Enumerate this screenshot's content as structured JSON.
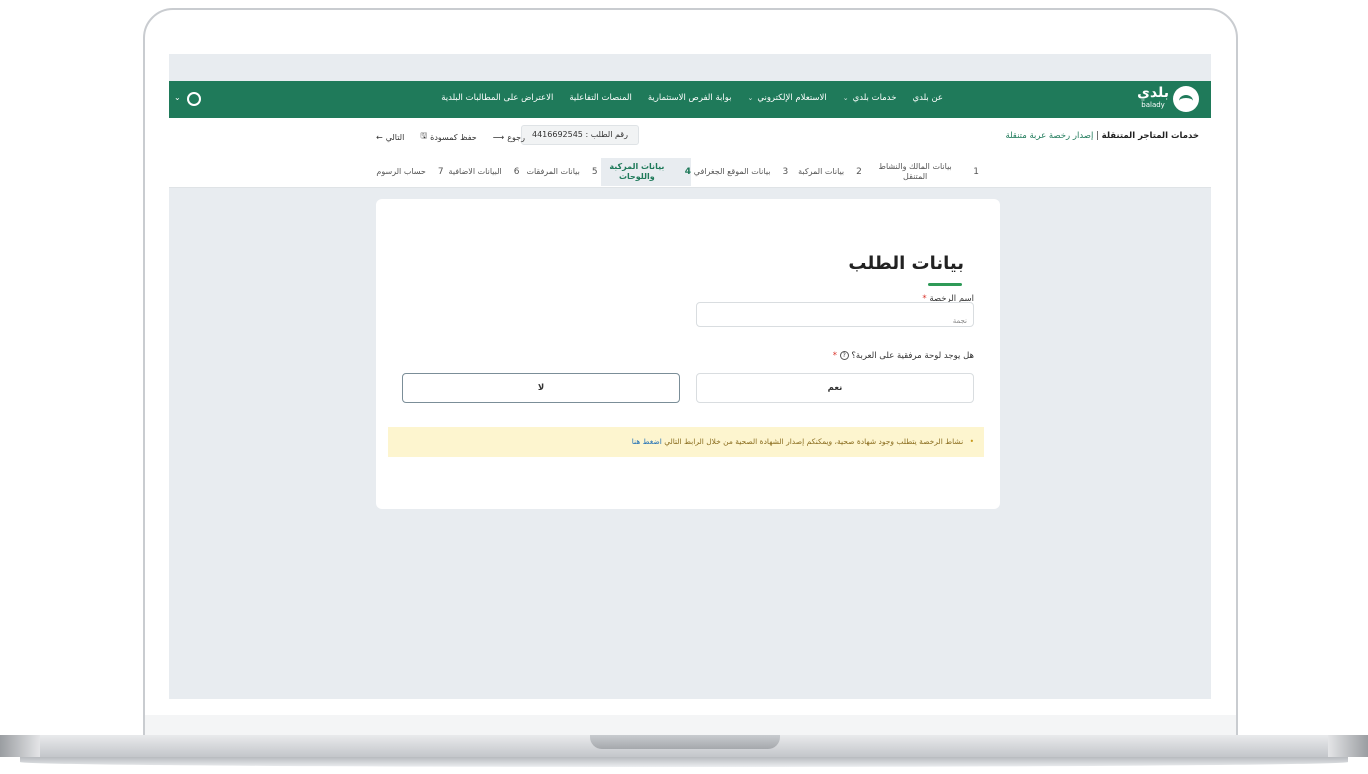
{
  "header": {
    "logo_text": "بلدي",
    "logo_sub": "balady",
    "nav": [
      {
        "label": "عن بلدي",
        "has_chevron": false
      },
      {
        "label": "خدمات بلدي",
        "has_chevron": true
      },
      {
        "label": "الاستعلام الإلكتروني",
        "has_chevron": true
      },
      {
        "label": "بوابة الفرص الاستثمارية",
        "has_chevron": false
      },
      {
        "label": "المنصات التفاعلية",
        "has_chevron": false
      },
      {
        "label": "الاعتراض على المطالبات البلدية",
        "has_chevron": false
      }
    ]
  },
  "breadcrumb": {
    "root": "خدمات المتاجر المتنقلة",
    "separator": "|",
    "current": "إصدار رخصة عربة متنقلة"
  },
  "order": {
    "label": "رقم الطلب : 4416692545"
  },
  "toolbar": {
    "back": "رجوع",
    "save_draft": "حفظ كمسودة",
    "next": "التالي"
  },
  "steps": [
    {
      "num": "1",
      "label": "بيانات المالك والنشاط المتنقل",
      "active": false
    },
    {
      "num": "2",
      "label": "بيانات المركبة",
      "active": false
    },
    {
      "num": "3",
      "label": "بيانات الموقع الجغرافي",
      "active": false
    },
    {
      "num": "4",
      "label": "بيانات المركبة واللوحات",
      "active": true
    },
    {
      "num": "5",
      "label": "بيانات المرفقات",
      "active": false
    },
    {
      "num": "6",
      "label": "البيانات الاضافية",
      "active": false
    },
    {
      "num": "7",
      "label": "حساب الرسوم",
      "active": false
    }
  ],
  "form": {
    "title": "بيانات الطلب",
    "license_name_label": "اسم الرخصة",
    "required_mark": "*",
    "license_name_value": "نجمة",
    "question": "هل يوجد لوحة مرفقية على العربة؟",
    "question_icon": "?",
    "option_yes": "نعم",
    "option_no": "لا",
    "notice_text": "نشاط الرخصة يتطلب وجود شهادة صحية، ويمكنكم إصدار الشهادة الصحية من خلال الرابط التالي",
    "notice_link": "اضغط هنا"
  },
  "colors": {
    "brand_green": "#1f7a5a",
    "accent_green": "#2e9a57",
    "notice_bg": "#fdf5cf",
    "required_red": "#d9342b"
  }
}
